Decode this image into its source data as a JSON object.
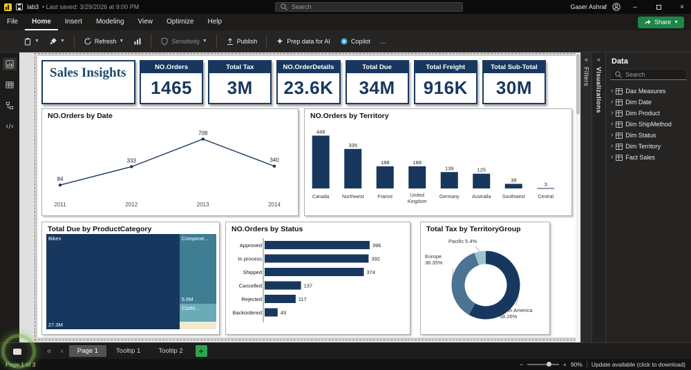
{
  "titlebar": {
    "file_name": "lab3",
    "saved_text": "• Last saved: 3/29/2026 at 9:00 PM",
    "search_placeholder": "Search",
    "user_name": "Gaser Ashraf"
  },
  "menubar": {
    "items": [
      "File",
      "Home",
      "Insert",
      "Modeling",
      "View",
      "Optimize",
      "Help"
    ],
    "active_item": "Home",
    "share_label": "Share"
  },
  "ribbon": {
    "refresh_label": "Refresh",
    "sensitivity_label": "Sensitivity",
    "publish_label": "Publish",
    "prep_ai_label": "Prep data for AI",
    "copilot_label": "Copilot",
    "more_label": "…"
  },
  "report": {
    "title": "Sales Insights",
    "kpi_cards": [
      {
        "title": "NO.Orders",
        "value": "1465"
      },
      {
        "title": "Total Tax",
        "value": "3M"
      },
      {
        "title": "NO.OrderDetails",
        "value": "23.6K"
      },
      {
        "title": "Total Due",
        "value": "34M"
      },
      {
        "title": "Total Freight",
        "value": "916K"
      },
      {
        "title": "Total Sub-Total",
        "value": "30M"
      }
    ]
  },
  "chart_data": [
    {
      "id": "orders_by_date",
      "type": "line",
      "title": "NO.Orders by Date",
      "x": [
        "2011",
        "2012",
        "2013",
        "2014"
      ],
      "values": [
        84,
        333,
        708,
        340
      ],
      "color": "#17375e",
      "ylim": [
        0,
        750
      ],
      "data_labels": true,
      "grid": false
    },
    {
      "id": "orders_by_territory",
      "type": "bar",
      "title": "NO.Orders by Territory",
      "categories": [
        "Canada",
        "Northwest",
        "France",
        "United Kingdom",
        "Germany",
        "Australia",
        "Southwest",
        "Central"
      ],
      "values": [
        448,
        335,
        188,
        188,
        139,
        125,
        39,
        3
      ],
      "color": "#17375e",
      "ylim": [
        0,
        480
      ],
      "data_labels": true,
      "grid": false
    },
    {
      "id": "due_by_productcategory",
      "type": "treemap",
      "title": "Total Due by ProductCategory",
      "items": [
        {
          "label": "Bikes",
          "value_label": "27.3M",
          "value": 27.3,
          "color": "#17375e"
        },
        {
          "label": "Compone...",
          "value_label": "5.5M",
          "value": 5.5,
          "color": "#3e7d92"
        },
        {
          "label": "Clothi...",
          "value_label": "",
          "value": 1.4,
          "color": "#6aabb8"
        },
        {
          "label": "",
          "value_label": "",
          "value": 0.6,
          "color": "#f0ead0"
        }
      ]
    },
    {
      "id": "orders_by_status",
      "type": "hbar",
      "title": "NO.Orders by Status",
      "categories": [
        "Approved",
        "In process",
        "Shipped",
        "Cancelled",
        "Rejected",
        "Backordered"
      ],
      "values": [
        396,
        392,
        374,
        137,
        117,
        49
      ],
      "color": "#17375e",
      "xlim": [
        0,
        430
      ],
      "data_labels": true,
      "grid": false
    },
    {
      "id": "tax_by_territorygroup",
      "type": "donut",
      "title": "Total Tax by TerritoryGroup",
      "slices": [
        {
          "label": "North America",
          "pct": 58.26,
          "color": "#17375e",
          "label_text": "North America 58.26%"
        },
        {
          "label": "Europe",
          "pct": 36.35,
          "color": "#4a7492",
          "label_text": "Europe 36.35%"
        },
        {
          "label": "Pacific",
          "pct": 5.4,
          "color": "#9dc3cf",
          "label_text": "Pacific 5.4%"
        }
      ]
    }
  ],
  "right_panels": {
    "filters_label": "Filters",
    "visualizations_label": "Visualizations",
    "data_panel": {
      "title": "Data",
      "search_placeholder": "Search",
      "items": [
        "Dax Measures",
        "Dim Date",
        "Dim Product",
        "Dim ShipMethod",
        "Dim Status",
        "Dim Territory",
        "Fact Sales"
      ]
    }
  },
  "pages_bar": {
    "tabs": [
      "Page 1",
      "Tooltip 1",
      "Tooltip 2"
    ],
    "active_tab": "Page 1",
    "add_label": "+"
  },
  "statusbar": {
    "page_indicator": "Page 1 of 3",
    "zoom_level": "90%",
    "update_text": "Update available (click to download)"
  },
  "colors": {
    "navy": "#17375e",
    "teal": "#3e7d92",
    "light_teal": "#6aabb8",
    "cream": "#f0ead0",
    "accent_green": "#2ea44f"
  }
}
